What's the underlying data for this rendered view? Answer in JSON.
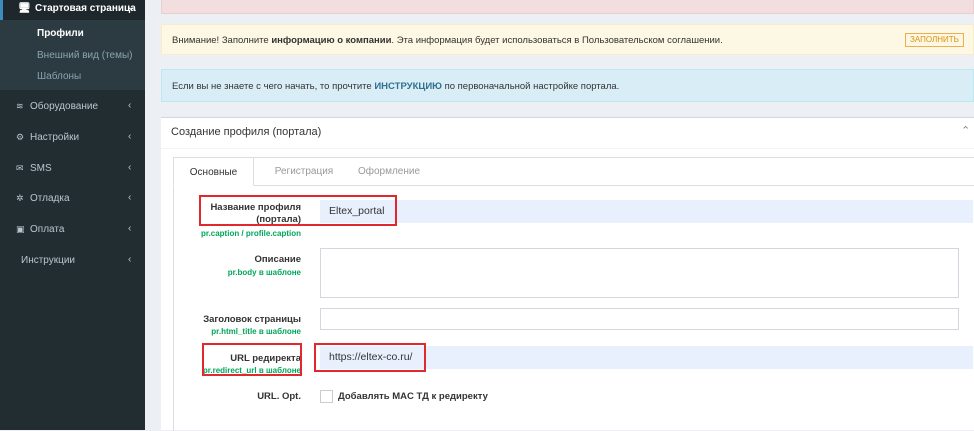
{
  "sidebar": {
    "head": {
      "icon": "monitor-icon",
      "label": "Стартовая страница"
    },
    "sub_items": [
      {
        "label": "Профили",
        "active": true
      },
      {
        "label": "Внешний вид (темы)",
        "active": false
      },
      {
        "label": "Шаблоны",
        "active": false
      }
    ],
    "items": [
      {
        "icon": "wifi-icon",
        "label": "Оборудование"
      },
      {
        "icon": "gears-icon",
        "label": "Настройки"
      },
      {
        "icon": "envelope-icon",
        "label": "SMS"
      },
      {
        "icon": "bug-icon",
        "label": "Отладка"
      },
      {
        "icon": "money-icon",
        "label": "Оплата"
      },
      {
        "icon": "",
        "label": "Инструкции"
      }
    ]
  },
  "alerts": {
    "warning": {
      "prefix": "Внимание! Заполните ",
      "bold": "информацию о компании",
      "suffix": ". Эта информация будет использоваться в Пользовательском соглашении.",
      "button": "ЗАПОЛНИТЬ"
    },
    "info": {
      "prefix": "Если вы не знаете с чего начать, то прочтите ",
      "link": "ИНСТРУКЦИЮ",
      "suffix": " по первоначальной настройке портала."
    }
  },
  "box": {
    "title": "Создание профиля (портала)",
    "tabs": [
      "Основные",
      "Регистрация",
      "Оформление"
    ]
  },
  "form": {
    "name": {
      "label_line1": "Название профиля",
      "label_line2": "(портала)",
      "hint": "pr.caption / profile.caption",
      "value": "Eltex_portal"
    },
    "description": {
      "label": "Описание",
      "hint": "pr.body в шаблоне",
      "value": ""
    },
    "page_title": {
      "label": "Заголовок страницы",
      "hint": "pr.html_title в шаблоне",
      "value": ""
    },
    "redirect": {
      "label": "URL редиректа",
      "hint": "pr.redirect_url в шаблоне",
      "value": "https://eltex-co.ru/"
    },
    "url_opt": {
      "label": "URL. Opt.",
      "checkbox_label": "Добавлять MAC ТД к редиректу",
      "checked": false
    }
  },
  "colors": {
    "sidebar_bg": "#222d32",
    "accent": "#3c8dbc",
    "hint_green": "#00a65a",
    "highlight_red": "#e0282e"
  }
}
